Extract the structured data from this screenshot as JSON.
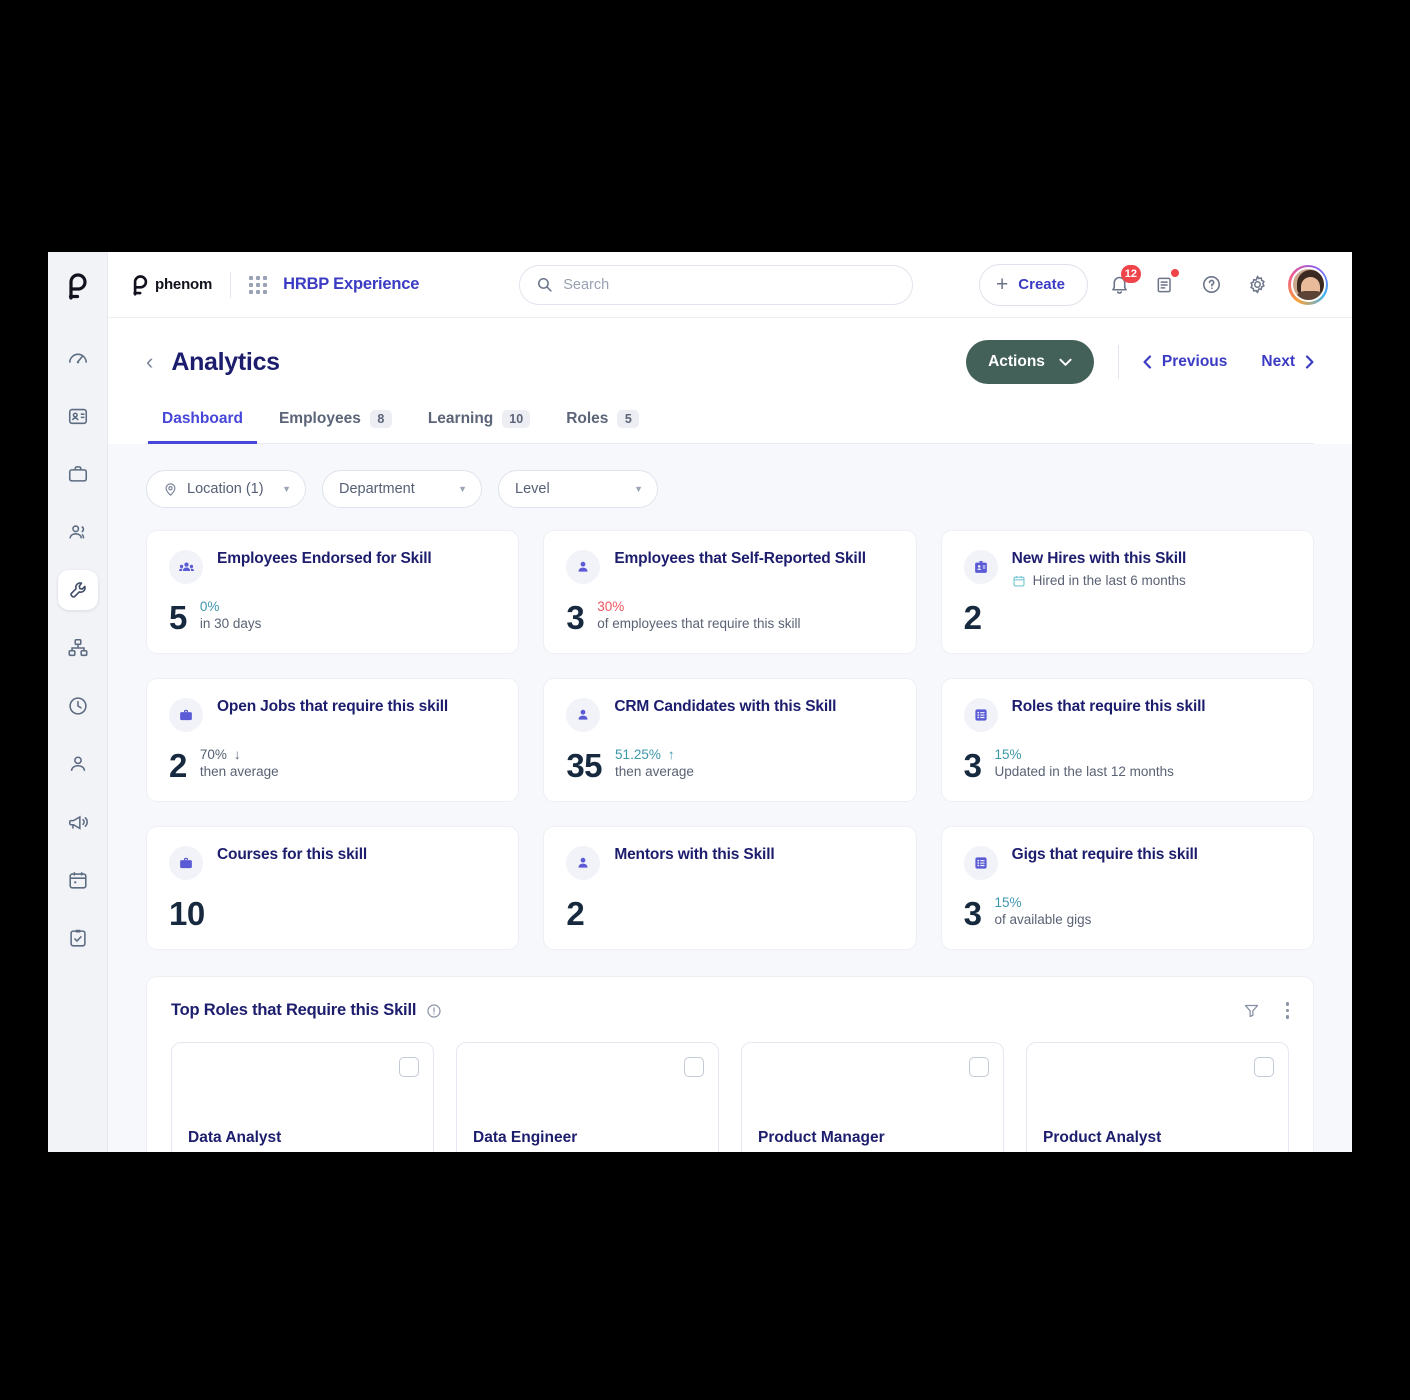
{
  "topbar": {
    "brand_word": "phenom",
    "app_switcher_icon": "grid-icon",
    "app_name": "HRBP Experience",
    "search_placeholder": "Search",
    "search_value": "",
    "create_label": "Create",
    "notifications_count": "12",
    "icons": [
      "bell-icon",
      "news-icon",
      "help-icon",
      "gear-icon",
      "avatar"
    ]
  },
  "page_header": {
    "back_label": "‹",
    "title": "Analytics",
    "actions_label": "Actions",
    "previous_label": "Previous",
    "next_label": "Next"
  },
  "tabs": [
    {
      "label": "Dashboard",
      "count": "",
      "active": true
    },
    {
      "label": "Employees",
      "count": "8",
      "active": false
    },
    {
      "label": "Learning",
      "count": "10",
      "active": false
    },
    {
      "label": "Roles",
      "count": "5",
      "active": false
    }
  ],
  "filters": [
    {
      "label": "Location (1)",
      "icon": "location-pin-icon"
    },
    {
      "label": "Department",
      "icon": ""
    },
    {
      "label": "Level",
      "icon": ""
    }
  ],
  "metric_cards": [
    {
      "icon": "group-people-icon",
      "title": "Employees Endorsed for Skill",
      "subtitle": "",
      "value": "5",
      "percent": "0%",
      "percent_color": "teal",
      "trend": "",
      "note": "in 30 days"
    },
    {
      "icon": "person-icon",
      "title": "Employees that Self-Reported Skill",
      "subtitle": "",
      "value": "3",
      "percent": "30%",
      "percent_color": "red",
      "trend": "",
      "note": "of employees that require this skill"
    },
    {
      "icon": "id-badge-icon",
      "title": "New Hires with this Skill",
      "subtitle": "Hired in the last 6 months",
      "value": "2",
      "percent": "",
      "percent_color": "",
      "trend": "",
      "note": ""
    },
    {
      "icon": "briefcase-icon",
      "title": "Open Jobs that require this skill",
      "subtitle": "",
      "value": "2",
      "percent": "70%",
      "percent_color": "gray",
      "trend": "↓",
      "note": "then average"
    },
    {
      "icon": "person-icon",
      "title": "CRM Candidates with this Skill",
      "subtitle": "",
      "value": "35",
      "percent": "51.25%",
      "percent_color": "teal",
      "trend": "↑",
      "note": "then average"
    },
    {
      "icon": "list-icon",
      "title": "Roles that require this skill",
      "subtitle": "",
      "value": "3",
      "percent": "15%",
      "percent_color": "teal",
      "trend": "",
      "note": "Updated in the last 12 months"
    },
    {
      "icon": "briefcase-icon",
      "title": "Courses for this skill",
      "subtitle": "",
      "value": "10",
      "percent": "",
      "percent_color": "",
      "trend": "",
      "note": ""
    },
    {
      "icon": "person-icon",
      "title": "Mentors with this Skill",
      "subtitle": "",
      "value": "2",
      "percent": "",
      "percent_color": "",
      "trend": "",
      "note": ""
    },
    {
      "icon": "list-icon",
      "title": "Gigs that require this skill",
      "subtitle": "",
      "value": "3",
      "percent": "15%",
      "percent_color": "teal",
      "trend": "",
      "note": "of available gigs"
    }
  ],
  "panel": {
    "title": "Top Roles that Require this Skill",
    "info_icon": "info-icon",
    "filter_icon": "funnel-filter-icon",
    "menu_icon": "kebab-menu-icon",
    "roles": [
      {
        "name": "Data Analyst"
      },
      {
        "name": "Data Engineer"
      },
      {
        "name": "Product Manager"
      },
      {
        "name": "Product Analyst"
      }
    ]
  },
  "sidebar": {
    "logo": "phenom-logo",
    "items": [
      {
        "icon": "speedometer-icon",
        "active": false
      },
      {
        "icon": "id-badge-icon",
        "active": false
      },
      {
        "icon": "briefcase-icon",
        "active": false
      },
      {
        "icon": "people-icon",
        "active": false
      },
      {
        "icon": "wrench-icon",
        "active": true
      },
      {
        "icon": "org-chart-icon",
        "active": false
      },
      {
        "icon": "clock-icon",
        "active": false
      },
      {
        "icon": "person-icon",
        "active": false
      },
      {
        "icon": "megaphone-icon",
        "active": false
      },
      {
        "icon": "calendar-icon",
        "active": false
      },
      {
        "icon": "clipboard-check-icon",
        "active": false
      }
    ]
  },
  "colors": {
    "accent_blue": "#4646d8",
    "title_navy": "#1d1d6e",
    "actions_green": "#436158",
    "teal": "#3d97ab",
    "red": "#f0555e",
    "value_navy": "#16293f",
    "page_bg": "#f7f8fb"
  }
}
